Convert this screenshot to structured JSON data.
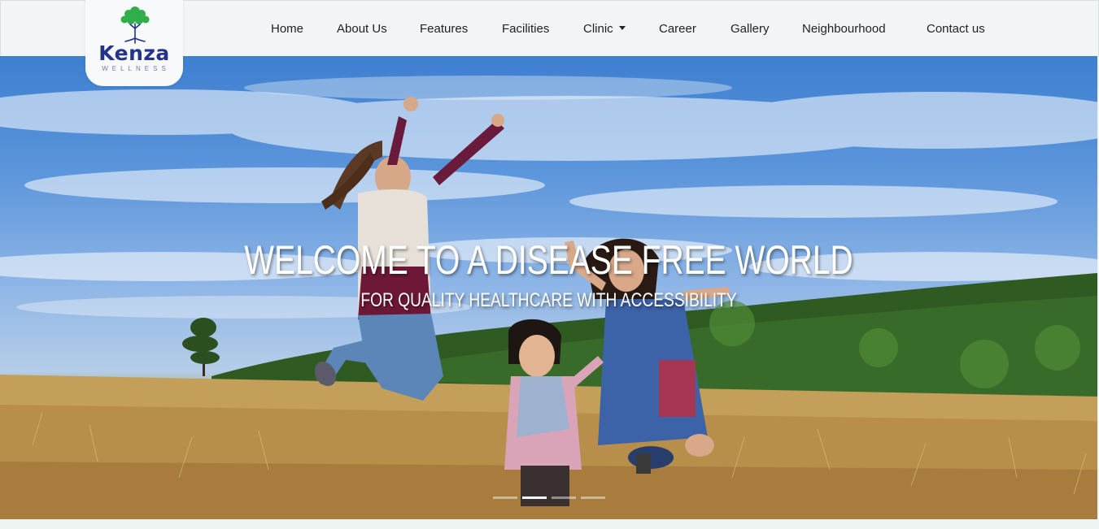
{
  "brand": {
    "name": "Kenza",
    "tagline": "WELLNESS",
    "tree_color": "#2fae49",
    "name_color": "#24338a"
  },
  "nav": {
    "items": [
      {
        "label": "Home"
      },
      {
        "label": "About Us"
      },
      {
        "label": "Features"
      },
      {
        "label": "Facilities"
      },
      {
        "label": "Clinic",
        "has_dropdown": true
      },
      {
        "label": "Career"
      },
      {
        "label": "Gallery"
      },
      {
        "label": "Neighbourhood"
      },
      {
        "label": "Contact us"
      }
    ]
  },
  "hero": {
    "title": "WELCOME TO A DISEASE FREE WORLD",
    "subtitle": "FOR QUALITY HEALTHCARE WITH ACCESSIBILITY",
    "slides_count": 4,
    "active_slide": 2
  }
}
